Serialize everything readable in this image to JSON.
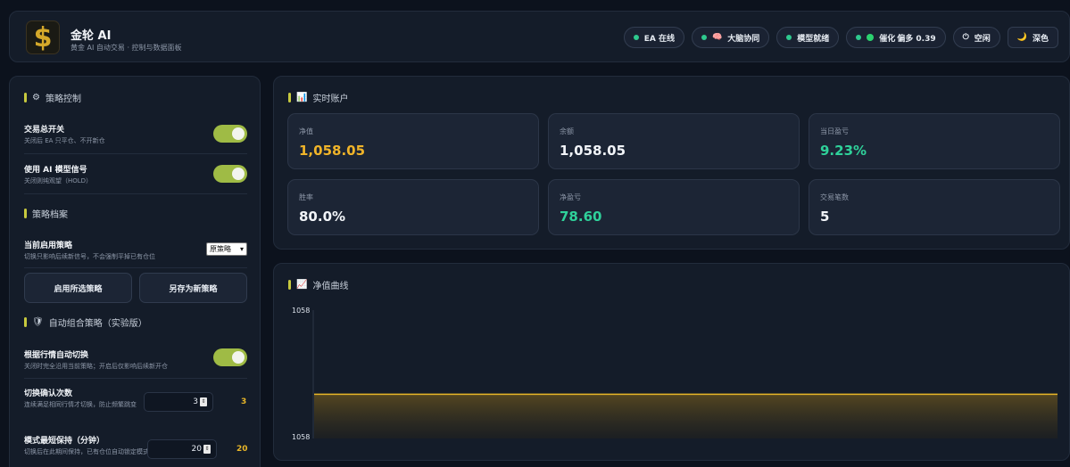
{
  "header": {
    "logo_glyph": "$",
    "title": "金轮 AI",
    "subtitle": "黄金 AI 自动交易 · 控制与数据面板",
    "pills": [
      {
        "label": "EA 在线",
        "icon": "green-dot",
        "icon_glyph": ""
      },
      {
        "label": "大脑协同",
        "icon": "brain-icon",
        "icon_glyph": "🧠"
      },
      {
        "label": "模型就绪",
        "icon": "green-dot",
        "icon_glyph": ""
      },
      {
        "label": "偏多 0.39",
        "prefix_label": "催化",
        "icon": "green-circle",
        "icon_glyph": ""
      },
      {
        "label": "空闲",
        "icon": "power-icon",
        "icon_glyph": "⏻"
      },
      {
        "label": "深色",
        "icon": "moon-icon",
        "icon_glyph": "🌙"
      }
    ]
  },
  "strategy": {
    "title": "策略控制",
    "title_icon": "⚙",
    "master": {
      "title": "交易总开关",
      "desc": "关闭后 EA 只平仓、不开新仓",
      "on": true
    },
    "ai_signal": {
      "title": "使用 AI 模型信号",
      "desc": "关闭则纯观望（HOLD）",
      "on": true
    },
    "profile_title": "策略档案",
    "current": {
      "title": "当前启用策略",
      "desc": "切换只影响后续新信号，不会强制平掉已有仓位",
      "selected": "原策略"
    },
    "apply_button": "启用所选策略",
    "save_button": "另存为新策略",
    "auto_title": "自动组合策略（实验版）",
    "auto_icon": "🛡",
    "auto_switch": {
      "title": "根据行情自动切换",
      "desc": "关闭时完全沿用当前策略；开启后仅影响后续新开仓",
      "on": true
    },
    "confirm": {
      "title": "切换确认次数",
      "desc": "连续满足相同行情才切换，防止频繁跳变",
      "value": "3",
      "side_value": "3"
    },
    "hold": {
      "title": "模式最短保持（分钟）",
      "desc": "切换后在此期间保持，已有仓位自动锁定模式",
      "value": "20",
      "side_value": "20"
    }
  },
  "account": {
    "title": "实时账户",
    "title_icon": "📊",
    "cards": [
      {
        "label": "净值",
        "value": "1,058.05",
        "color": "#f0b429"
      },
      {
        "label": "余额",
        "value": "1,058.05",
        "color": "#f1f4f8"
      },
      {
        "label": "当日盈亏",
        "value": "9.23%",
        "color": "#2fd19a"
      },
      {
        "label": "胜率",
        "value": "80.0%",
        "color": "#f1f4f8"
      },
      {
        "label": "净盈亏",
        "value": "78.60",
        "color": "#2fd19a"
      },
      {
        "label": "交易笔数",
        "value": "5",
        "color": "#f1f4f8"
      }
    ]
  },
  "equity_curve": {
    "title": "净值曲线",
    "title_icon": "📈",
    "y_top_label": "1058",
    "y_bottom_label": "1058"
  },
  "chart_data": {
    "type": "area",
    "title": "净值曲线",
    "x": [
      0,
      1
    ],
    "series": [
      {
        "values": [
          1058.05,
          1058.05
        ]
      }
    ],
    "ylim": [
      1058,
      1058.1
    ],
    "line_color": "#e8b628",
    "grid": false
  }
}
